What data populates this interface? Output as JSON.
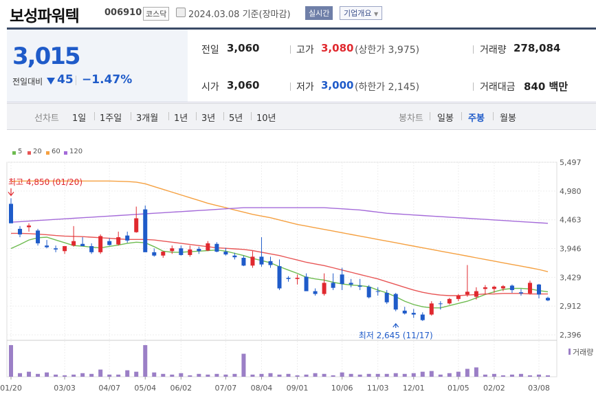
{
  "header": {
    "name": "보성파워텍",
    "code": "006910",
    "market": "코스닥",
    "date": "2024.03.08",
    "basis": "기준(장마감)",
    "realtime_label": "실시간",
    "company_info_label": "기업개요"
  },
  "quote": {
    "price": "3,015",
    "change_label": "전일대비",
    "change": "45",
    "change_pct": "−1.47%",
    "prev_close_label": "전일",
    "prev_close": "3,060",
    "open_label": "시가",
    "open": "3,060",
    "high_label": "고가",
    "high": "3,080",
    "upper_limit": "(상한가 3,975)",
    "low_label": "저가",
    "low": "3,000",
    "lower_limit": "(하한가 2,145)",
    "volume_label": "거래량",
    "volume": "278,084",
    "amount_label": "거래대금",
    "amount": "840 백만",
    "colors": {
      "down": "#1f5bc9",
      "up": "#e0292f"
    }
  },
  "nav": {
    "line_chart_label": "선차트",
    "periods": [
      "1일",
      "1주일",
      "3개월",
      "1년",
      "3년",
      "5년",
      "10년"
    ],
    "candle_label": "봉차트",
    "candle_types": [
      "일봉",
      "주봉",
      "월봉"
    ],
    "active_candle": "주봉"
  },
  "chart_data": {
    "type": "candlestick",
    "interval": "weekly",
    "ylim": [
      2396,
      5497
    ],
    "y_ticks": [
      5497,
      4980,
      4463,
      3946,
      3429,
      2912,
      2396
    ],
    "x_ticks": [
      "01/20",
      "03/03",
      "04/07",
      "05/04",
      "06/02",
      "07/07",
      "08/04",
      "09/01",
      "10/06",
      "11/03",
      "12/01",
      "01/05",
      "02/02",
      "03/08"
    ],
    "x_tick_index": [
      0,
      6,
      11,
      15,
      19,
      24,
      28,
      32,
      37,
      41,
      45,
      50,
      54,
      59
    ],
    "legend": [
      {
        "name": "5",
        "color": "#6dbb4f"
      },
      {
        "name": "20",
        "color": "#e85555"
      },
      {
        "name": "60",
        "color": "#f5a040"
      },
      {
        "name": "120",
        "color": "#a46ad9"
      }
    ],
    "annotations": {
      "high": {
        "label": "최고 4,850 (01/20)",
        "value": 4850,
        "index": 0
      },
      "low": {
        "label": "최저 2,645 (11/17)",
        "value": 2645,
        "index": 43
      }
    },
    "volume_label": "거래량",
    "candles": [
      {
        "o": 4750,
        "h": 4850,
        "l": 4500,
        "c": 4400
      },
      {
        "o": 4300,
        "h": 4350,
        "l": 4150,
        "c": 4200
      },
      {
        "o": 4330,
        "h": 4400,
        "l": 4250,
        "c": 4360
      },
      {
        "o": 4270,
        "h": 4300,
        "l": 4000,
        "c": 4040
      },
      {
        "o": 4000,
        "h": 4100,
        "l": 3950,
        "c": 3970
      },
      {
        "o": 3950,
        "h": 4000,
        "l": 3880,
        "c": 3930
      },
      {
        "o": 3900,
        "h": 3990,
        "l": 3850,
        "c": 3990
      },
      {
        "o": 4000,
        "h": 4350,
        "l": 3980,
        "c": 4080
      },
      {
        "o": 4030,
        "h": 4150,
        "l": 3990,
        "c": 3990
      },
      {
        "o": 3990,
        "h": 4040,
        "l": 3850,
        "c": 3880
      },
      {
        "o": 3880,
        "h": 4200,
        "l": 3850,
        "c": 4170
      },
      {
        "o": 4080,
        "h": 4130,
        "l": 4000,
        "c": 4010
      },
      {
        "o": 4020,
        "h": 4250,
        "l": 4000,
        "c": 4150
      },
      {
        "o": 4180,
        "h": 4250,
        "l": 4050,
        "c": 4090
      },
      {
        "o": 4240,
        "h": 4700,
        "l": 4230,
        "c": 4490
      },
      {
        "o": 4650,
        "h": 4720,
        "l": 3900,
        "c": 3880
      },
      {
        "o": 3880,
        "h": 3950,
        "l": 3800,
        "c": 3820
      },
      {
        "o": 3820,
        "h": 3900,
        "l": 3780,
        "c": 3890
      },
      {
        "o": 3900,
        "h": 4000,
        "l": 3850,
        "c": 3950
      },
      {
        "o": 3950,
        "h": 4000,
        "l": 3820,
        "c": 3830
      },
      {
        "o": 3830,
        "h": 4000,
        "l": 3800,
        "c": 3930
      },
      {
        "o": 3940,
        "h": 3980,
        "l": 3850,
        "c": 3900
      },
      {
        "o": 3910,
        "h": 4080,
        "l": 3900,
        "c": 4040
      },
      {
        "o": 4030,
        "h": 4060,
        "l": 3880,
        "c": 3890
      },
      {
        "o": 3890,
        "h": 3960,
        "l": 3820,
        "c": 3840
      },
      {
        "o": 3820,
        "h": 3870,
        "l": 3750,
        "c": 3790
      },
      {
        "o": 3780,
        "h": 3820,
        "l": 3630,
        "c": 3640
      },
      {
        "o": 3640,
        "h": 3900,
        "l": 3600,
        "c": 3800
      },
      {
        "o": 3800,
        "h": 4150,
        "l": 3620,
        "c": 3660
      },
      {
        "o": 3720,
        "h": 3800,
        "l": 3600,
        "c": 3650
      },
      {
        "o": 3630,
        "h": 3750,
        "l": 3200,
        "c": 3230
      },
      {
        "o": 3420,
        "h": 3450,
        "l": 3350,
        "c": 3400
      },
      {
        "o": 3400,
        "h": 3480,
        "l": 3300,
        "c": 3420
      },
      {
        "o": 3440,
        "h": 3500,
        "l": 3200,
        "c": 3180
      },
      {
        "o": 3180,
        "h": 3230,
        "l": 3100,
        "c": 3130
      },
      {
        "o": 3130,
        "h": 3500,
        "l": 3100,
        "c": 3330
      },
      {
        "o": 3330,
        "h": 3500,
        "l": 3200,
        "c": 3240
      },
      {
        "o": 3480,
        "h": 3600,
        "l": 3200,
        "c": 3310
      },
      {
        "o": 3330,
        "h": 3400,
        "l": 3250,
        "c": 3300
      },
      {
        "o": 3280,
        "h": 3400,
        "l": 3200,
        "c": 3260
      },
      {
        "o": 3260,
        "h": 3290,
        "l": 3050,
        "c": 3070
      },
      {
        "o": 3180,
        "h": 3250,
        "l": 3100,
        "c": 3170
      },
      {
        "o": 3150,
        "h": 3200,
        "l": 2950,
        "c": 2980
      },
      {
        "o": 3130,
        "h": 3150,
        "l": 2820,
        "c": 2850
      },
      {
        "o": 2830,
        "h": 2900,
        "l": 2760,
        "c": 2780
      },
      {
        "o": 2790,
        "h": 2860,
        "l": 2700,
        "c": 2760
      },
      {
        "o": 2760,
        "h": 2800,
        "l": 2645,
        "c": 2660
      },
      {
        "o": 2760,
        "h": 3000,
        "l": 2740,
        "c": 2960
      },
      {
        "o": 2960,
        "h": 3000,
        "l": 2850,
        "c": 2950
      },
      {
        "o": 2960,
        "h": 3060,
        "l": 2940,
        "c": 3040
      },
      {
        "o": 3040,
        "h": 3130,
        "l": 3000,
        "c": 3100
      },
      {
        "o": 3120,
        "h": 3650,
        "l": 3080,
        "c": 3170
      },
      {
        "o": 3080,
        "h": 3250,
        "l": 3030,
        "c": 3180
      },
      {
        "o": 3220,
        "h": 3290,
        "l": 3130,
        "c": 3250
      },
      {
        "o": 3220,
        "h": 3280,
        "l": 3150,
        "c": 3260
      },
      {
        "o": 3230,
        "h": 3290,
        "l": 3180,
        "c": 3270
      },
      {
        "o": 3280,
        "h": 3300,
        "l": 3150,
        "c": 3200
      },
      {
        "o": 3160,
        "h": 3220,
        "l": 3100,
        "c": 3140
      },
      {
        "o": 3140,
        "h": 3370,
        "l": 3120,
        "c": 3330
      },
      {
        "o": 3300,
        "h": 3310,
        "l": 3050,
        "c": 3120
      },
      {
        "o": 3060,
        "h": 3080,
        "l": 3000,
        "c": 3015
      }
    ],
    "volume": [
      44,
      5,
      7,
      4,
      6,
      3,
      2,
      3,
      5,
      4,
      10,
      3,
      3,
      9,
      7,
      44,
      6,
      4,
      3,
      5,
      2,
      4,
      3,
      4,
      3,
      4,
      32,
      3,
      4,
      5,
      3,
      4,
      2,
      3,
      5,
      4,
      2,
      6,
      4,
      3,
      4,
      4,
      4,
      5,
      4,
      5,
      7,
      8,
      3,
      5,
      7,
      11,
      13,
      3,
      4,
      2,
      3,
      4,
      2,
      3,
      2
    ],
    "ma5": [
      3946,
      4020,
      4100,
      4140,
      4150,
      4100,
      4050,
      4000,
      3990,
      3970,
      3960,
      3985,
      4010,
      4040,
      4060,
      4050,
      3980,
      3900,
      3880,
      3880,
      3890,
      3900,
      3910,
      3920,
      3900,
      3860,
      3820,
      3770,
      3730,
      3690,
      3620,
      3560,
      3500,
      3430,
      3400,
      3380,
      3340,
      3310,
      3290,
      3280,
      3260,
      3200,
      3150,
      3080,
      3000,
      2940,
      2900,
      2880,
      2880,
      2920,
      2960,
      3000,
      3060,
      3120,
      3170,
      3210,
      3230,
      3230,
      3220,
      3190,
      3170
    ],
    "ma20": [
      4220,
      4220,
      4215,
      4205,
      4195,
      4180,
      4170,
      4165,
      4160,
      4150,
      4140,
      4130,
      4120,
      4110,
      4110,
      4110,
      4100,
      4080,
      4060,
      4040,
      4020,
      4000,
      3980,
      3960,
      3950,
      3940,
      3930,
      3910,
      3880,
      3850,
      3820,
      3780,
      3740,
      3700,
      3670,
      3640,
      3600,
      3560,
      3520,
      3480,
      3440,
      3400,
      3350,
      3300,
      3250,
      3200,
      3160,
      3130,
      3110,
      3100,
      3100,
      3110,
      3120,
      3130,
      3130,
      3140,
      3140,
      3140,
      3130,
      3130,
      3130
    ],
    "ma60": [
      5150,
      5160,
      5160,
      5160,
      5160,
      5160,
      5160,
      5160,
      5160,
      5160,
      5160,
      5160,
      5155,
      5150,
      5140,
      5110,
      5060,
      5010,
      4960,
      4910,
      4860,
      4810,
      4760,
      4720,
      4680,
      4640,
      4600,
      4560,
      4530,
      4500,
      4460,
      4420,
      4380,
      4350,
      4320,
      4290,
      4260,
      4230,
      4200,
      4170,
      4140,
      4110,
      4080,
      4050,
      4020,
      3990,
      3960,
      3930,
      3900,
      3870,
      3840,
      3810,
      3780,
      3750,
      3720,
      3690,
      3660,
      3630,
      3600,
      3570,
      3530
    ],
    "ma120": [
      4420,
      4430,
      4440,
      4450,
      4460,
      4470,
      4480,
      4490,
      4500,
      4510,
      4520,
      4530,
      4540,
      4550,
      4560,
      4570,
      4580,
      4590,
      4600,
      4610,
      4620,
      4630,
      4640,
      4650,
      4660,
      4670,
      4680,
      4680,
      4680,
      4680,
      4680,
      4680,
      4680,
      4680,
      4680,
      4680,
      4670,
      4660,
      4650,
      4640,
      4620,
      4600,
      4580,
      4570,
      4560,
      4550,
      4540,
      4530,
      4520,
      4510,
      4500,
      4490,
      4480,
      4470,
      4460,
      4450,
      4440,
      4430,
      4420,
      4410,
      4400
    ]
  }
}
